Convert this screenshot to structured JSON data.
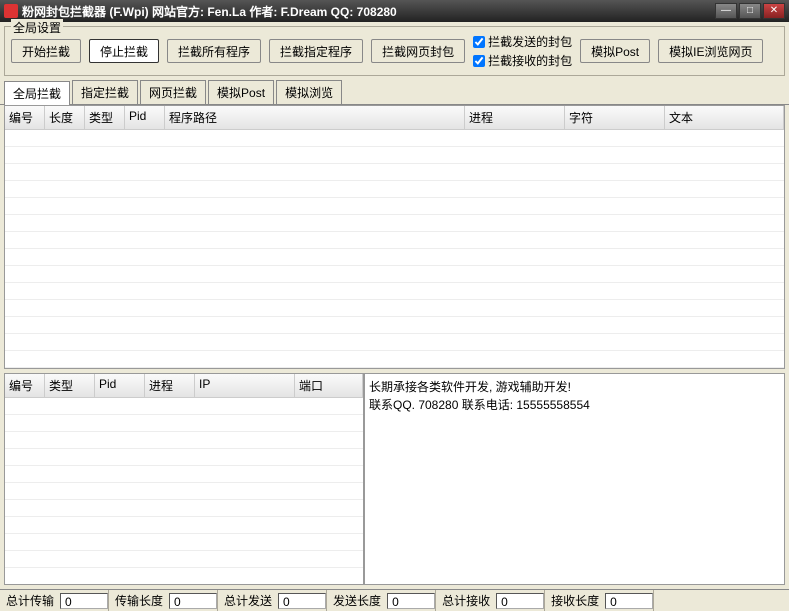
{
  "titlebar": "粉网封包拦截器 (F.Wpi) 网站官方: Fen.La 作者: F.Dream QQ: 708280",
  "group_title": "全局设置",
  "buttons": {
    "start": "开始拦截",
    "stop": "停止拦截",
    "all": "拦截所有程序",
    "specific": "拦截指定程序",
    "web": "拦截网页封包",
    "post": "模拟Post",
    "ie": "模拟IE浏览网页"
  },
  "checks": {
    "send": "拦截发送的封包",
    "recv": "拦截接收的封包"
  },
  "tabs": [
    "全局拦截",
    "指定拦截",
    "网页拦截",
    "模拟Post",
    "模拟浏览"
  ],
  "main_cols": [
    "编号",
    "长度",
    "类型",
    "Pid",
    "程序路径",
    "进程",
    "字符",
    "文本"
  ],
  "lower_cols": [
    "编号",
    "类型",
    "Pid",
    "进程",
    "IP",
    "端口"
  ],
  "info": "长期承接各类软件开发, 游戏辅助开发!\n联系QQ. 708280 联系电话: 15555558554",
  "status": {
    "total_transfer_label": "总计传输",
    "total_transfer_val": "0",
    "transfer_len_label": "传输长度",
    "transfer_len_val": "0",
    "total_send_label": "总计发送",
    "total_send_val": "0",
    "send_len_label": "发送长度",
    "send_len_val": "0",
    "total_recv_label": "总计接收",
    "total_recv_val": "0",
    "recv_len_label": "接收长度",
    "recv_len_val": "0"
  }
}
